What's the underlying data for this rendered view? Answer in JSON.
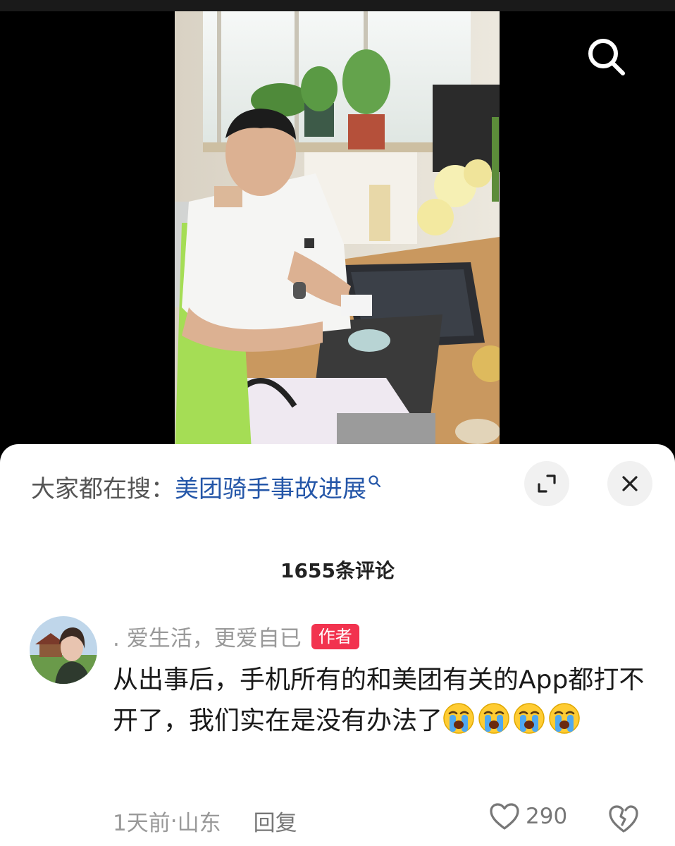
{
  "search_bar": {
    "prefix": "大家都在搜：",
    "query": "美团骑手事故进展"
  },
  "comments": {
    "count_label": "1655条评论",
    "items": [
      {
        "author": ". 爱生活，更爱自已",
        "badge": "作者",
        "text": "从出事后，手机所有的和美团有关的App都打不开了，我们实在是没有办法了",
        "emojis": [
          "loudly-crying-face",
          "loudly-crying-face",
          "loudly-crying-face",
          "loudly-crying-face"
        ],
        "time": "1天前",
        "location": "山东",
        "separator": " · ",
        "reply_label": "回复",
        "likes": "290"
      }
    ]
  },
  "icons": {
    "search": "search-icon",
    "expand": "expand-icon",
    "close": "close-icon",
    "like": "heart-icon",
    "dislike": "broken-heart-icon"
  },
  "colors": {
    "link": "#2456a8",
    "badge": "#f2334f",
    "muted": "#999999"
  }
}
